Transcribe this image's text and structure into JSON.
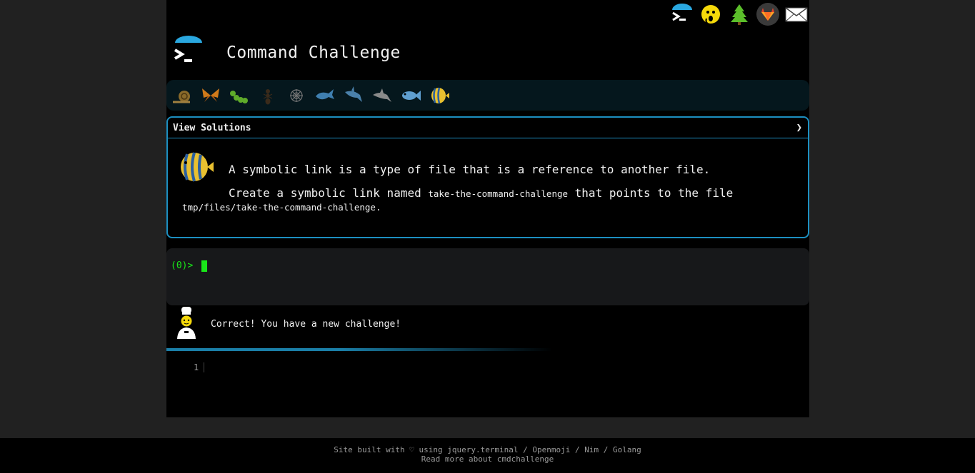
{
  "header": {
    "title": "Command Challenge"
  },
  "top_icons": [
    {
      "name": "cmdchallenge-logo-icon"
    },
    {
      "name": "hushed-face-icon"
    },
    {
      "name": "tree-icon"
    },
    {
      "name": "gitlab-icon"
    },
    {
      "name": "envelope-icon"
    }
  ],
  "levels": [
    {
      "name": "snail-icon",
      "color": "#8a6a2a"
    },
    {
      "name": "butterfly-icon",
      "color": "#d07a1a"
    },
    {
      "name": "caterpillar-icon",
      "color": "#5faa2a"
    },
    {
      "name": "ant-icon",
      "color": "#3a2a1a"
    },
    {
      "name": "spider-web-icon",
      "color": "#777777"
    },
    {
      "name": "whale-icon",
      "color": "#3f7fb0"
    },
    {
      "name": "shark-icon",
      "color": "#4a80aa"
    },
    {
      "name": "dolphin-icon",
      "color": "#8a8a8a"
    },
    {
      "name": "fish-icon",
      "color": "#5f9fd0"
    },
    {
      "name": "tropical-fish-icon",
      "color": "#e8c030"
    }
  ],
  "challenge": {
    "solutions_label": "View Solutions",
    "chevron": "❯",
    "line1": "A symbolic link is a type of file that is a reference to another file.",
    "line2_prefix": "Create a symbolic link named ",
    "line2_code": "take-the-command-challenge",
    "line2_suffix": " that points to the file",
    "line3_code": "tmp/files/take-the-command-challenge",
    "line3_suffix": "."
  },
  "terminal": {
    "prompt": "(0)>"
  },
  "message": {
    "text": "Correct! You have a new challenge!"
  },
  "editor": {
    "line_number": "1"
  },
  "footer": {
    "line1": "Site built with ♡ using jquery.terminal / Openmoji / Nim / Golang",
    "line2": "Read more about cmdchallenge"
  },
  "colors": {
    "accent": "#1c8fc1",
    "prompt": "#19e619"
  }
}
